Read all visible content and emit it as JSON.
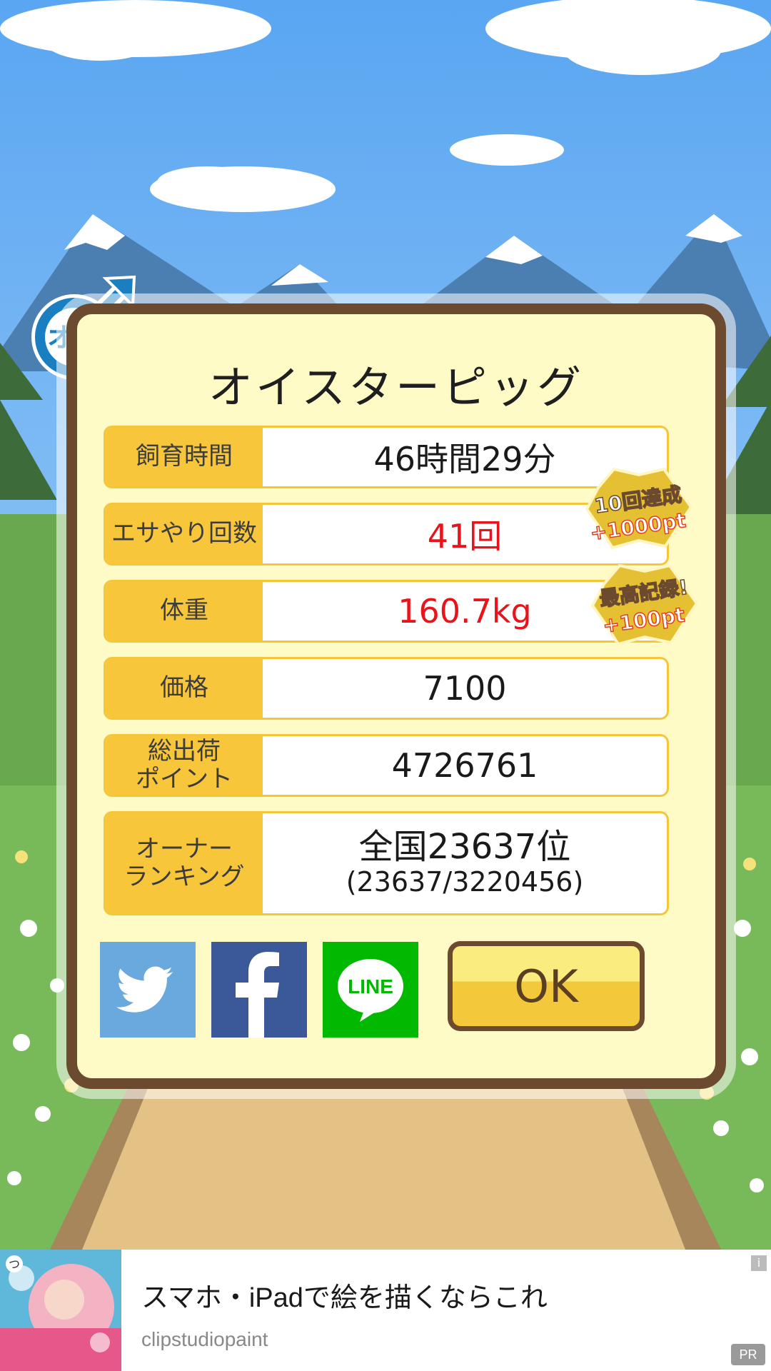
{
  "dialog": {
    "title": "オイスターピッグ",
    "gender_badge_text": "オス",
    "stats": [
      {
        "label": "飼育時間",
        "value": "46時間29分",
        "highlight": false
      },
      {
        "label": "エサやり回数",
        "value": "41回",
        "highlight": true
      },
      {
        "label": "体重",
        "value": "160.7kg",
        "highlight": true
      },
      {
        "label": "価格",
        "value": "7100",
        "highlight": false
      },
      {
        "label": "総出荷\nポイント",
        "value": "4726761",
        "highlight": false
      }
    ],
    "ranking": {
      "label": "オーナー\nランキング",
      "main": "全国23637位",
      "sub": "(23637/3220456)"
    },
    "seals": [
      {
        "line1": "10回達成",
        "line2": "+1000pt"
      },
      {
        "line1": "最高記録!",
        "line2": "+100pt"
      }
    ],
    "share": {
      "twitter_color": "#6aa9dd",
      "facebook_color": "#3b5998",
      "line_color": "#00b900",
      "line_label": "LINE"
    },
    "ok_label": "OK"
  },
  "ad": {
    "title": "スマホ・iPadで絵を描くならこれ",
    "domain": "clipstudiopaint",
    "info": "i",
    "pr": "PR"
  }
}
